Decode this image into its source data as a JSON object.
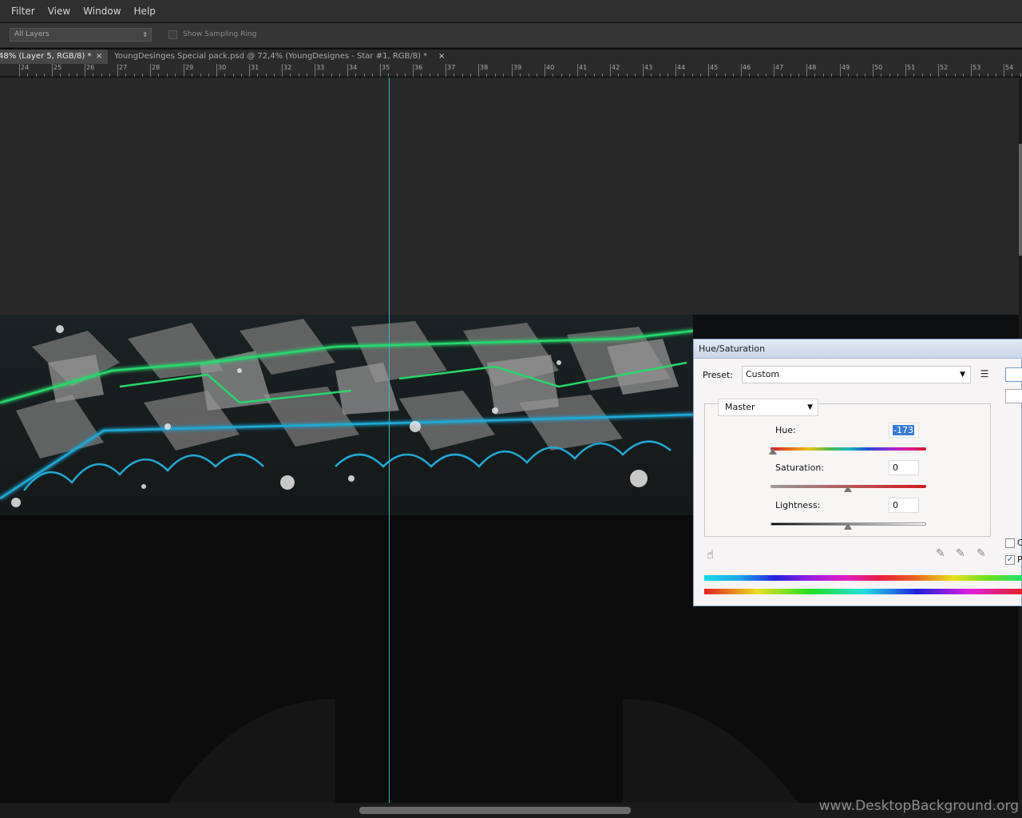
{
  "menu": {
    "items": [
      "Filter",
      "View",
      "Window",
      "Help"
    ]
  },
  "options_bar": {
    "sample_value": "All Layers",
    "sampling_ring_label": "Show Sampling Ring"
  },
  "tabs": {
    "active_label": "48% (Layer 5, RGB/8) *",
    "inactive_label": "YoungDesinges Special pack.psd @ 72,4% (YoungDesignes - Star #1, RGB/8) *",
    "close_glyph": "×"
  },
  "ruler": {
    "labels": [
      "24",
      "25",
      "26",
      "27",
      "28",
      "29",
      "30",
      "31",
      "32",
      "33",
      "34",
      "35",
      "36",
      "37",
      "38",
      "39",
      "40",
      "41",
      "42",
      "43",
      "44",
      "45",
      "46",
      "47",
      "48",
      "49",
      "50",
      "51",
      "52",
      "53",
      "54"
    ]
  },
  "dialog": {
    "title": "Hue/Saturation",
    "preset_label": "Preset:",
    "preset_value": "Custom",
    "channel_value": "Master",
    "hue_label": "Hue:",
    "hue_value": "-173",
    "saturation_label": "Saturation:",
    "saturation_value": "0",
    "lightness_label": "Lightness:",
    "lightness_value": "0",
    "colorize_letter": "C",
    "preview_letter": "P",
    "preview_checked": true,
    "colorize_checked": false
  },
  "watermark": "www.DesktopBackground.org",
  "colors": {
    "guide": "#35b6c9",
    "neon_green": "#27d86a",
    "neon_blue": "#1fa9d6"
  }
}
